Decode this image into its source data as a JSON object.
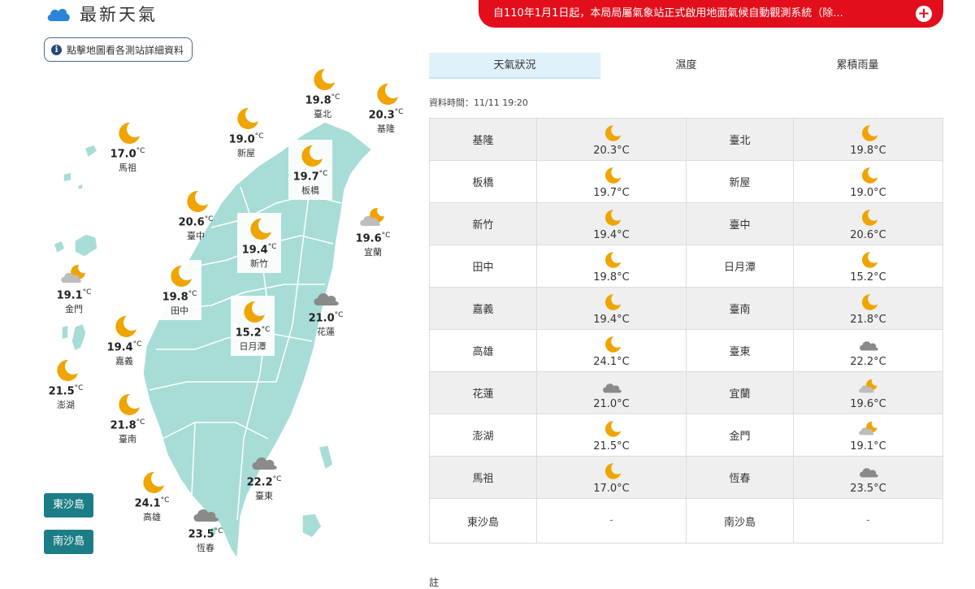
{
  "page": {
    "title": "最新天氣",
    "notice": "自110年1月1日起，本局局屬氣象站正式啟用地面氣候自動觀測系統（除...",
    "map_hint": "點擊地圖看各測站詳細資料",
    "data_time": "資料時間：11/11 19:20",
    "note": "註"
  },
  "tabs": [
    {
      "label": "天氣狀況",
      "active": true
    },
    {
      "label": "濕度",
      "active": false
    },
    {
      "label": "累積雨量",
      "active": false
    }
  ],
  "islands": [
    "東沙島",
    "南沙島"
  ],
  "unit": "°C",
  "map_stations": [
    {
      "name": "臺北",
      "temp": "19.8",
      "icon": "moon-icon"
    },
    {
      "name": "基隆",
      "temp": "20.3",
      "icon": "moon-icon"
    },
    {
      "name": "新屋",
      "temp": "19.0",
      "icon": "moon-icon"
    },
    {
      "name": "板橋",
      "temp": "19.7",
      "icon": "moon-icon"
    },
    {
      "name": "馬祖",
      "temp": "17.0",
      "icon": "moon-icon"
    },
    {
      "name": "臺中",
      "temp": "20.6",
      "icon": "moon-icon"
    },
    {
      "name": "宜蘭",
      "temp": "19.6",
      "icon": "partly-cloudy-night-icon"
    },
    {
      "name": "新竹",
      "temp": "19.4",
      "icon": "moon-icon"
    },
    {
      "name": "金門",
      "temp": "19.1",
      "icon": "partly-cloudy-night-icon"
    },
    {
      "name": "田中",
      "temp": "19.8",
      "icon": "moon-icon"
    },
    {
      "name": "花蓮",
      "temp": "21.0",
      "icon": "cloudy-icon"
    },
    {
      "name": "嘉義",
      "temp": "19.4",
      "icon": "moon-icon"
    },
    {
      "name": "日月潭",
      "temp": "15.2",
      "icon": "moon-icon"
    },
    {
      "name": "澎湖",
      "temp": "21.5",
      "icon": "moon-icon"
    },
    {
      "name": "臺南",
      "temp": "21.8",
      "icon": "moon-icon"
    },
    {
      "name": "臺東",
      "temp": "22.2",
      "icon": "cloudy-icon"
    },
    {
      "name": "高雄",
      "temp": "24.1",
      "icon": "moon-icon"
    },
    {
      "name": "恆春",
      "temp": "23.5",
      "icon": "cloudy-icon"
    }
  ],
  "table_rows": [
    [
      {
        "name": "基隆",
        "temp": "20.3°C",
        "icon": "moon-icon"
      },
      {
        "name": "臺北",
        "temp": "19.8°C",
        "icon": "moon-icon"
      }
    ],
    [
      {
        "name": "板橋",
        "temp": "19.7°C",
        "icon": "moon-icon"
      },
      {
        "name": "新屋",
        "temp": "19.0°C",
        "icon": "moon-icon"
      }
    ],
    [
      {
        "name": "新竹",
        "temp": "19.4°C",
        "icon": "moon-icon"
      },
      {
        "name": "臺中",
        "temp": "20.6°C",
        "icon": "moon-icon"
      }
    ],
    [
      {
        "name": "田中",
        "temp": "19.8°C",
        "icon": "moon-icon"
      },
      {
        "name": "日月潭",
        "temp": "15.2°C",
        "icon": "moon-icon"
      }
    ],
    [
      {
        "name": "嘉義",
        "temp": "19.4°C",
        "icon": "moon-icon"
      },
      {
        "name": "臺南",
        "temp": "21.8°C",
        "icon": "moon-icon"
      }
    ],
    [
      {
        "name": "高雄",
        "temp": "24.1°C",
        "icon": "moon-icon"
      },
      {
        "name": "臺東",
        "temp": "22.2°C",
        "icon": "cloudy-icon"
      }
    ],
    [
      {
        "name": "花蓮",
        "temp": "21.0°C",
        "icon": "cloudy-icon"
      },
      {
        "name": "宜蘭",
        "temp": "19.6°C",
        "icon": "partly-cloudy-night-icon"
      }
    ],
    [
      {
        "name": "澎湖",
        "temp": "21.5°C",
        "icon": "moon-icon"
      },
      {
        "name": "金門",
        "temp": "19.1°C",
        "icon": "partly-cloudy-night-icon"
      }
    ],
    [
      {
        "name": "馬祖",
        "temp": "17.0°C",
        "icon": "moon-icon"
      },
      {
        "name": "恆春",
        "temp": "23.5°C",
        "icon": "cloudy-icon"
      }
    ],
    [
      {
        "name": "東沙島",
        "temp": "-",
        "icon": ""
      },
      {
        "name": "南沙島",
        "temp": "-",
        "icon": ""
      }
    ]
  ],
  "colors": {
    "land": "#a7ddd6",
    "notice_red": "#e20e1b",
    "island_button": "#1d7d86",
    "tab_active": "#dff1fb",
    "moon": "#f0a400",
    "cloud": "#8a8a8a"
  }
}
